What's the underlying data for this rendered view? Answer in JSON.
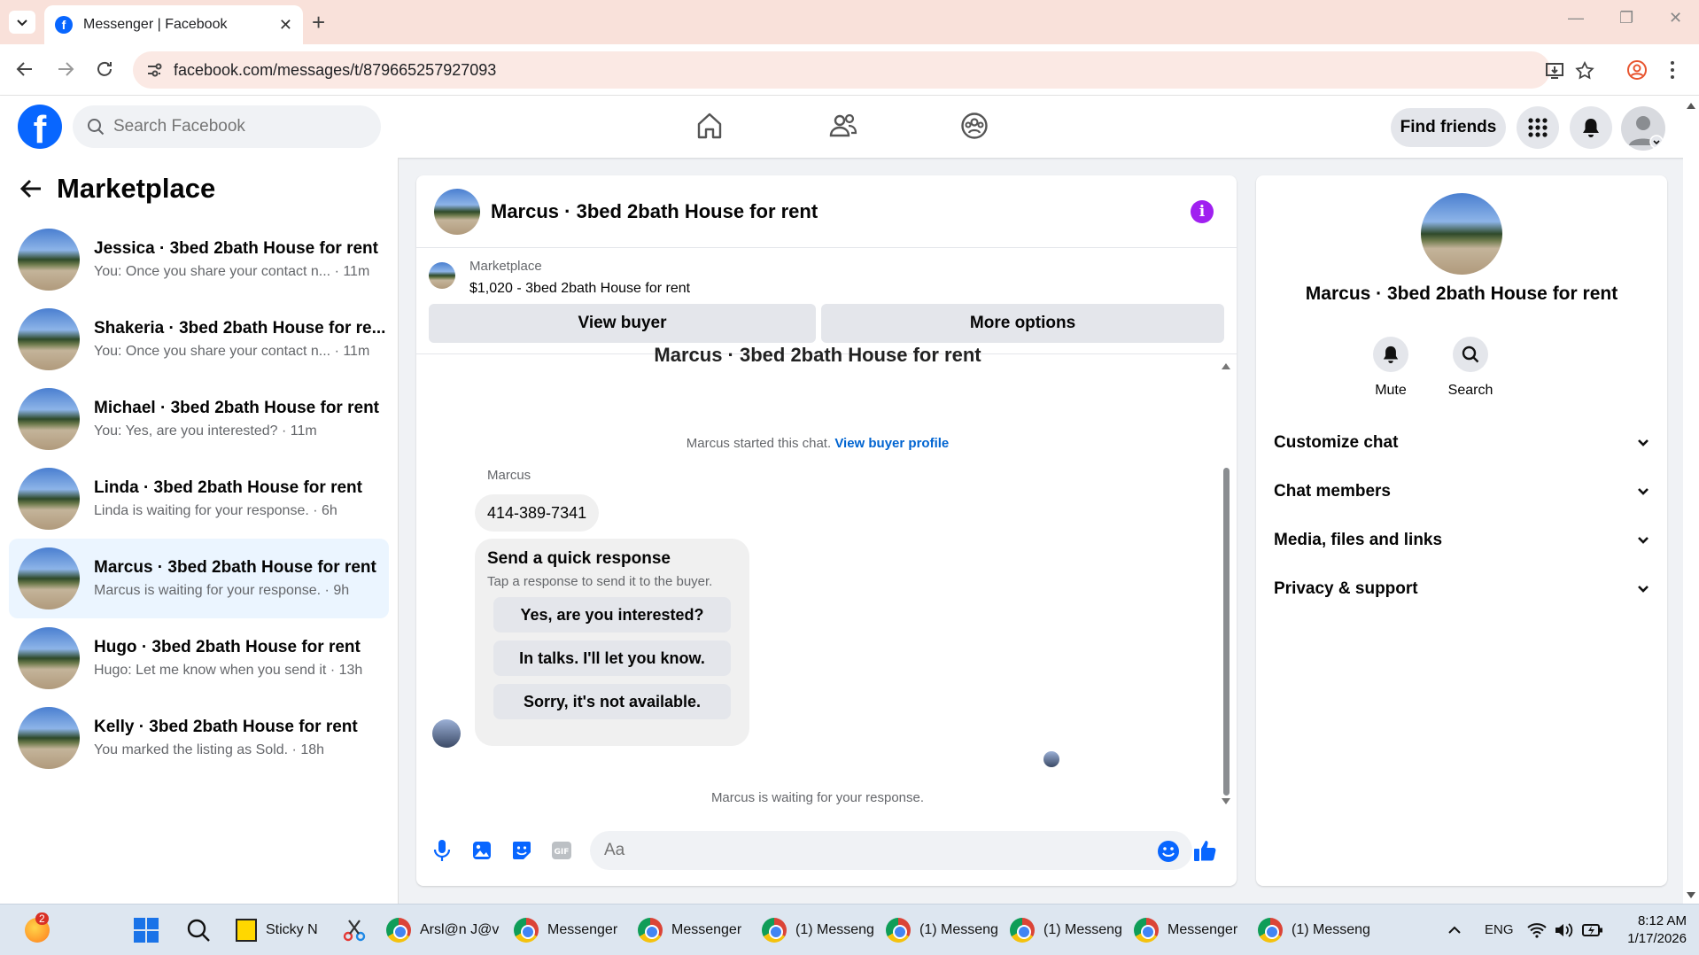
{
  "browser": {
    "tab_title": "Messenger | Facebook",
    "url": "facebook.com/messages/t/879665257927093",
    "new_tab_label": "+",
    "tab_close": "✕"
  },
  "fb_header": {
    "search_placeholder": "Search Facebook",
    "find_friends": "Find friends"
  },
  "sidebar": {
    "title": "Marketplace",
    "conversations": [
      {
        "name": "Jessica · 3bed 2bath House for rent",
        "preview": "You: Once you share your contact n... · 11m"
      },
      {
        "name": "Shakeria · 3bed 2bath House for re...",
        "preview": "You: Once you share your contact n... · 11m"
      },
      {
        "name": "Michael · 3bed 2bath House for rent",
        "preview": "You: Yes, are you interested? · 11m"
      },
      {
        "name": "Linda · 3bed 2bath House for rent",
        "preview": "Linda is waiting for your response. · 6h"
      },
      {
        "name": "Marcus · 3bed 2bath House for rent",
        "preview": "Marcus is waiting for your response. · 9h"
      },
      {
        "name": "Hugo · 3bed 2bath House for rent",
        "preview": "Hugo: Let me know when you send it · 13h"
      },
      {
        "name": "Kelly · 3bed 2bath House for rent",
        "preview": "You marked the listing as Sold. · 18h"
      }
    ]
  },
  "chat": {
    "title": "Marcus · 3bed 2bath House for rent",
    "listing_source": "Marketplace",
    "listing_price_title": "$1,020 - 3bed 2bath House for rent",
    "view_buyer": "View buyer",
    "more_options": "More options",
    "cut_title": "Marcus · 3bed 2bath House for rent",
    "started_text": "Marcus started this chat.",
    "view_buyer_profile": "View buyer profile",
    "sender_name": "Marcus",
    "phone_message": "414-389-7341",
    "quick_title": "Send a quick response",
    "quick_subtitle": "Tap a response to send it to the buyer.",
    "quick_responses": [
      "Yes, are you interested?",
      "In talks. I'll let you know.",
      "Sorry, it's not available."
    ],
    "waiting_text": "Marcus is waiting for your response.",
    "composer_placeholder": "Aa"
  },
  "details": {
    "title": "Marcus · 3bed 2bath House for rent",
    "mute": "Mute",
    "search": "Search",
    "sections": [
      "Customize chat",
      "Chat members",
      "Media, files and links",
      "Privacy & support"
    ]
  },
  "taskbar": {
    "badge_count": "2",
    "sticky": "Sticky N",
    "items": [
      "Arsl@n J@v",
      "Messenger",
      "Messenger",
      "(1) Messeng",
      "(1) Messeng",
      "(1) Messeng",
      "Messenger",
      "(1) Messeng"
    ],
    "lang": "ENG",
    "time": "8:12 AM",
    "date": "1/17/2026"
  },
  "colors": {
    "fb_blue": "#0866ff",
    "active_conv": "#ebf5ff",
    "info_purple": "#a020f0"
  }
}
